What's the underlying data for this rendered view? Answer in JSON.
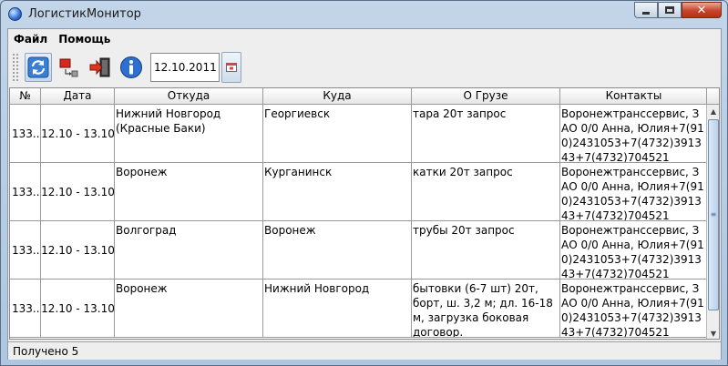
{
  "window": {
    "title": "ЛогистикМонитор",
    "controls": {
      "minimize": "minimize-icon",
      "maximize": "maximize-icon",
      "close": "✕"
    }
  },
  "menu": {
    "file": "Файл",
    "help": "Помощь"
  },
  "toolbar": {
    "refresh_icon": "refresh-icon",
    "filter_icon": "filter-icon",
    "exit_icon": "exit-icon",
    "info_icon": "info-icon",
    "date_value": "12.10.2011",
    "calendar_icon": "calendar-icon"
  },
  "table": {
    "columns": [
      "№",
      "Дата",
      "Откуда",
      "Куда",
      "О Грузе",
      "Контакты"
    ],
    "rows": [
      {
        "num": "133...",
        "date": "12.10 - 13.10",
        "from": "Нижний Новгород (Красные Баки)",
        "to": "Георгиевск",
        "cargo": "тара 20т запрос",
        "contacts": "Воронежтранссервис, ЗАО 0/0 Анна, Юлия+7(910)2431053+7(4732)391343+7(4732)704521"
      },
      {
        "num": "133...",
        "date": "12.10 - 13.10",
        "from": "Воронеж",
        "to": "Курганинск",
        "cargo": "катки 20т запрос",
        "contacts": "Воронежтранссервис, ЗАО 0/0 Анна, Юлия+7(910)2431053+7(4732)391343+7(4732)704521"
      },
      {
        "num": "133...",
        "date": "12.10 - 13.10",
        "from": "Волгоград",
        "to": "Воронеж",
        "cargo": "трубы 20т запрос",
        "contacts": "Воронежтранссервис, ЗАО 0/0 Анна, Юлия+7(910)2431053+7(4732)391343+7(4732)704521"
      },
      {
        "num": "133...",
        "date": "12.10 - 13.10",
        "from": "Воронеж",
        "to": "Нижний Новгород",
        "cargo": "бытовки (6-7 шт) 20т, борт, ш. 3,2 м; дл. 16-18 м, загрузка боковая договор.",
        "contacts": "Воронежтранссервис, ЗАО 0/0 Анна, Юлия+7(910)2431053+7(4732)391343+7(4732)704521"
      }
    ]
  },
  "status": {
    "text": "Получено 5"
  },
  "colors": {
    "titlebar": "#c3d5e8",
    "client": "#eeeeee",
    "close_button": "#c7432a",
    "grid_line": "#9a9a9a"
  }
}
